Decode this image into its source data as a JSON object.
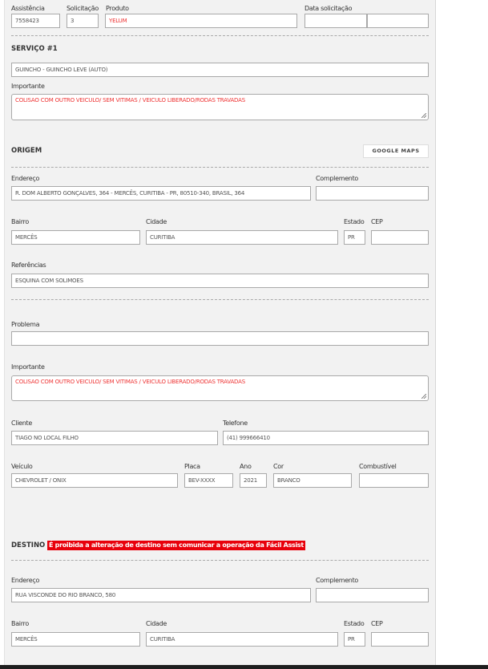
{
  "header": {
    "assistencia": {
      "label": "Assistência",
      "value": "7558423"
    },
    "solicitacao": {
      "label": "Solicitação",
      "value": "3"
    },
    "produto": {
      "label": "Produto",
      "value": "YELUM"
    },
    "data_solicitacao": {
      "label": "Data solicitação",
      "date": "",
      "time": ""
    }
  },
  "servico": {
    "title": "SERVIÇO #1",
    "value": "GUINCHO - GUINCHO LEVE (AUTO)",
    "importante_label": "Importante",
    "importante": "COLISAO COM OUTRO VEICULO/ SEM VITIMAS / VEICULO LIBERADO/RODAS TRAVADAS"
  },
  "origem": {
    "title": "ORIGEM",
    "maps_button": "GOOGLE MAPS",
    "endereco_label": "Endereço",
    "endereco": "R. DOM ALBERTO GONÇALVES, 364 - MERCÊS, CURITIBA - PR, 80510-340, BRASIL, 364",
    "complemento_label": "Complemento",
    "complemento": "",
    "bairro_label": "Bairro",
    "bairro": "MERCÊS",
    "cidade_label": "Cidade",
    "cidade": "CURITIBA",
    "estado_label": "Estado",
    "estado": "PR",
    "cep_label": "CEP",
    "cep": "",
    "referencias_label": "Referências",
    "referencias": "ESQUINA COM SOLIMOES"
  },
  "problema": {
    "label": "Problema",
    "value": "",
    "importante_label": "Importante",
    "importante": "COLISAO COM OUTRO VEICULO/ SEM VITIMAS / VEICULO LIBERADO/RODAS TRAVADAS"
  },
  "cliente": {
    "label": "Cliente",
    "value": "TIAGO NO LOCAL FILHO",
    "telefone_label": "Telefone",
    "telefone": "(41) 999666410"
  },
  "veiculo": {
    "label": "Veículo",
    "value": "CHEVROLET / ONIX",
    "placa_label": "Placa",
    "placa": "BEV-XXXX",
    "ano_label": "Ano",
    "ano": "2021",
    "cor_label": "Cor",
    "cor": "BRANCO",
    "combustivel_label": "Combustível",
    "combustivel": ""
  },
  "destino": {
    "title": "DESTINO",
    "warning": "É proibida a alteração de destino sem comunicar a operação da Fácil Assist",
    "warning_color": "#e8000b",
    "endereco_label": "Endereço",
    "endereco": "RUA VISCONDE DO RIO BRANCO, 580",
    "complemento_label": "Complemento",
    "complemento": "",
    "bairro_label": "Bairro",
    "bairro": "MERCÊS",
    "cidade_label": "Cidade",
    "cidade": "CURITIBA",
    "estado_label": "Estado",
    "estado": "PR",
    "cep_label": "CEP",
    "cep": ""
  }
}
